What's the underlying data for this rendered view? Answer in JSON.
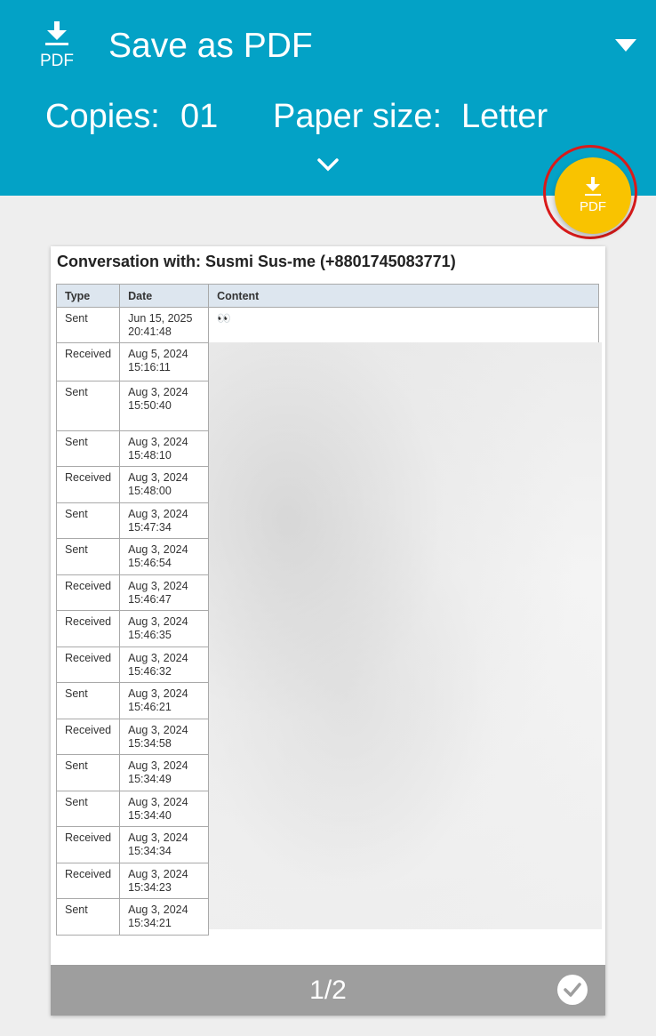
{
  "header": {
    "icon": "pdf-download-icon",
    "icon_text": "PDF",
    "title": "Save as PDF",
    "copies_label": "Copies:",
    "copies_value": "01",
    "paper_size_label": "Paper size:",
    "paper_size_value": "Letter",
    "bg_color": "#03a2c6"
  },
  "fab": {
    "icon": "pdf-download-icon",
    "label": "PDF",
    "color": "#f9c300",
    "highlight_color": "#d91a1a"
  },
  "preview": {
    "title": "Conversation with: Susmi Sus-me (+8801745083771)",
    "columns": [
      "Type",
      "Date",
      "Content"
    ],
    "rows": [
      {
        "type": "Sent",
        "date": "Jun 15, 2025",
        "time": "20:41:48",
        "content": "👀"
      },
      {
        "type": "Received",
        "date": "Aug 5, 2024",
        "time": "15:16:11",
        "content": ""
      },
      {
        "type": "Sent",
        "date": "Aug 3, 2024",
        "time": "15:50:40",
        "content": ""
      },
      {
        "type": "Sent",
        "date": "Aug 3, 2024",
        "time": "15:48:10",
        "content": ""
      },
      {
        "type": "Received",
        "date": "Aug 3, 2024",
        "time": "15:48:00",
        "content": ""
      },
      {
        "type": "Sent",
        "date": "Aug 3, 2024",
        "time": "15:47:34",
        "content": ""
      },
      {
        "type": "Sent",
        "date": "Aug 3, 2024",
        "time": "15:46:54",
        "content": ""
      },
      {
        "type": "Received",
        "date": "Aug 3, 2024",
        "time": "15:46:47",
        "content": ""
      },
      {
        "type": "Received",
        "date": "Aug 3, 2024",
        "time": "15:46:35",
        "content": ""
      },
      {
        "type": "Received",
        "date": "Aug 3, 2024",
        "time": "15:46:32",
        "content": ""
      },
      {
        "type": "Sent",
        "date": "Aug 3, 2024",
        "time": "15:46:21",
        "content": ""
      },
      {
        "type": "Received",
        "date": "Aug 3, 2024",
        "time": "15:34:58",
        "content": ""
      },
      {
        "type": "Sent",
        "date": "Aug 3, 2024",
        "time": "15:34:49",
        "content": ""
      },
      {
        "type": "Sent",
        "date": "Aug 3, 2024",
        "time": "15:34:40",
        "content": ""
      },
      {
        "type": "Received",
        "date": "Aug 3, 2024",
        "time": "15:34:34",
        "content": ""
      },
      {
        "type": "Received",
        "date": "Aug 3, 2024",
        "time": "15:34:23",
        "content": ""
      },
      {
        "type": "Sent",
        "date": "Aug 3, 2024",
        "time": "15:34:21",
        "content": ""
      }
    ],
    "page_indicator": "1/2",
    "selected_icon": "check-circle-icon"
  }
}
